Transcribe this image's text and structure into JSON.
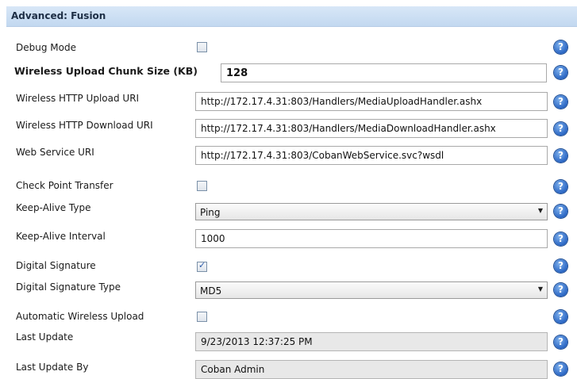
{
  "panel": {
    "title": "Advanced: Fusion"
  },
  "fields": {
    "debug_mode": {
      "label": "Debug Mode",
      "checked": false
    },
    "chunk_size": {
      "label": "Wireless Upload Chunk Size (KB)",
      "value": "128"
    },
    "upload_uri": {
      "label": "Wireless HTTP Upload URI",
      "value": "http://172.17.4.31:803/Handlers/MediaUploadHandler.ashx"
    },
    "download_uri": {
      "label": "Wireless HTTP Download URI",
      "value": "http://172.17.4.31:803/Handlers/MediaDownloadHandler.ashx"
    },
    "web_service_uri": {
      "label": "Web Service URI",
      "value": "http://172.17.4.31:803/CobanWebService.svc?wsdl"
    },
    "check_point": {
      "label": "Check Point Transfer",
      "checked": false
    },
    "keep_alive_type": {
      "label": "Keep-Alive Type",
      "value": "Ping"
    },
    "keep_alive_interval": {
      "label": "Keep-Alive Interval",
      "value": "1000"
    },
    "digital_signature": {
      "label": "Digital Signature",
      "checked": true
    },
    "digital_signature_type": {
      "label": "Digital Signature Type",
      "value": "MD5"
    },
    "auto_upload": {
      "label": "Automatic Wireless Upload",
      "checked": false
    },
    "last_update": {
      "label": "Last Update",
      "value": "9/23/2013 12:37:25 PM"
    },
    "last_update_by": {
      "label": "Last Update By",
      "value": "Coban Admin"
    }
  },
  "help_glyph": "?",
  "icons": {
    "help": "help-icon",
    "dropdown": "chevron-down-icon",
    "check": "check-icon"
  },
  "colors": {
    "header_bg": "#c9ddf2",
    "help_blue": "#2a66c4",
    "readonly_bg": "#e8e8e8"
  }
}
